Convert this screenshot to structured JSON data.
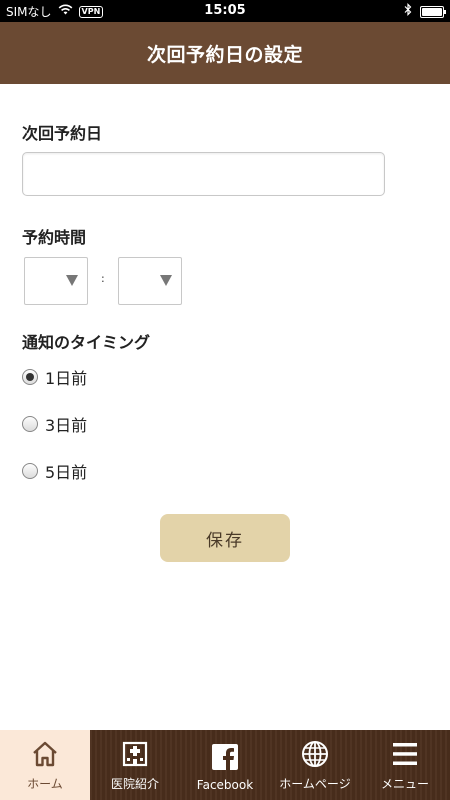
{
  "status_bar": {
    "carrier": "SIMなし",
    "vpn": "VPN",
    "time": "15:05"
  },
  "header": {
    "title": "次回予約日の設定"
  },
  "form": {
    "next_date_label": "次回予約日",
    "next_date_value": "",
    "time_label": "予約時間",
    "hour_value": "",
    "minute_value": "",
    "time_separator": ":",
    "timing_label": "通知のタイミング",
    "timing_options": [
      {
        "label": "1日前",
        "checked": true
      },
      {
        "label": "3日前",
        "checked": false
      },
      {
        "label": "5日前",
        "checked": false
      }
    ],
    "save_label": "保存"
  },
  "tabbar": {
    "items": [
      {
        "label": "ホーム",
        "icon": "home-icon",
        "active": true
      },
      {
        "label": "医院紹介",
        "icon": "hospital-icon",
        "active": false
      },
      {
        "label": "Facebook",
        "icon": "facebook-icon",
        "active": false
      },
      {
        "label": "ホームページ",
        "icon": "globe-icon",
        "active": false
      },
      {
        "label": "メニュー",
        "icon": "menu-icon",
        "active": false
      }
    ]
  },
  "colors": {
    "header_bg": "#6b4a33",
    "tabbar_bg": "#4a2e1c",
    "active_tab_bg": "#fbe8d8",
    "save_button_bg": "#e3d3a9"
  }
}
